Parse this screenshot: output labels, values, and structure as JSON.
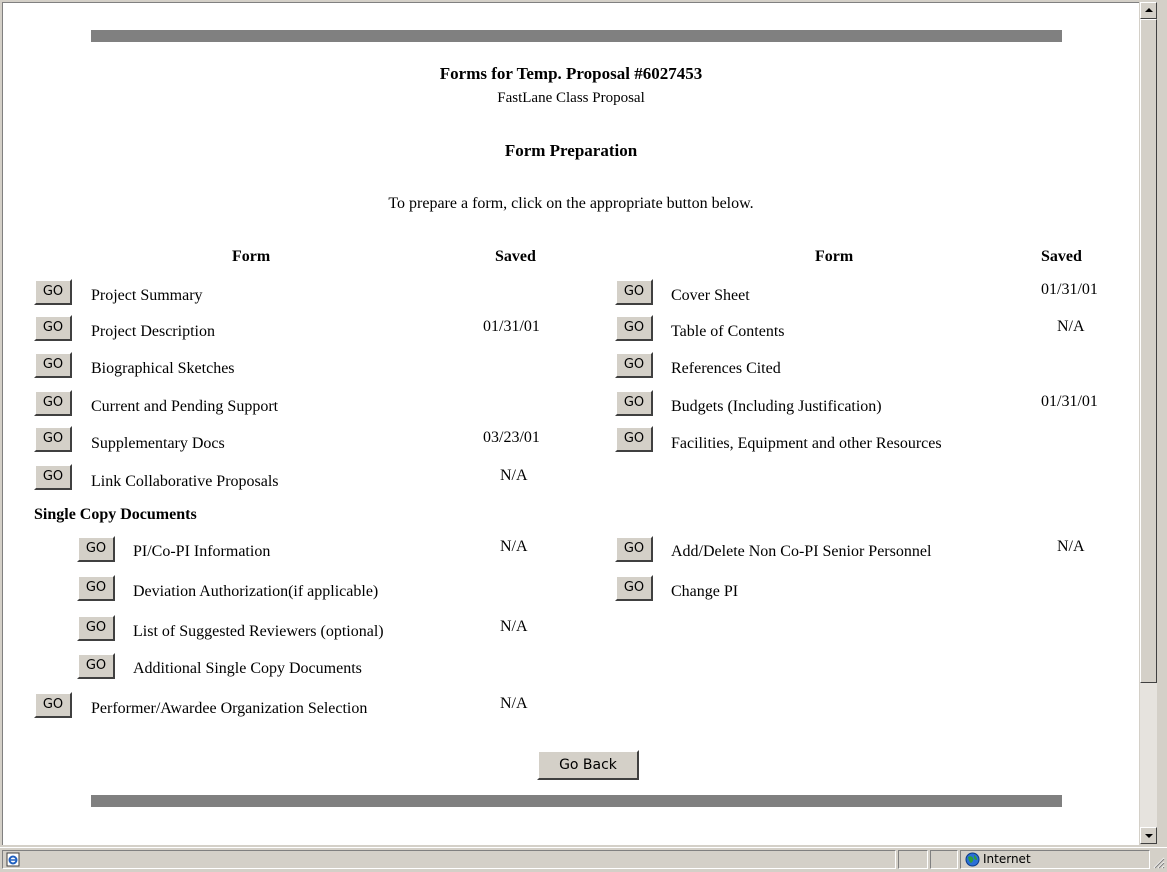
{
  "header": {
    "title": "Forms for Temp. Proposal #6027453",
    "subtitle": "FastLane Class Proposal",
    "section": "Form Preparation",
    "instruction": "To prepare a form, click on the appropriate button below."
  },
  "columns": {
    "form": "Form",
    "saved": "Saved"
  },
  "go_label": "GO",
  "left_forms": [
    {
      "label": "Project Summary",
      "saved": ""
    },
    {
      "label": "Project Description",
      "saved": "01/31/01"
    },
    {
      "label": "Biographical Sketches",
      "saved": ""
    },
    {
      "label": "Current and Pending Support",
      "saved": ""
    },
    {
      "label": "Supplementary Docs",
      "saved": "03/23/01"
    },
    {
      "label": "Link Collaborative Proposals",
      "saved": "N/A"
    }
  ],
  "right_forms": [
    {
      "label": "Cover Sheet",
      "saved": "01/31/01"
    },
    {
      "label": "Table of Contents",
      "saved": "N/A"
    },
    {
      "label": "References Cited",
      "saved": ""
    },
    {
      "label": "Budgets (Including Justification)",
      "saved": "01/31/01"
    },
    {
      "label": "Facilities, Equipment and other Resources",
      "saved": ""
    }
  ],
  "single_copy": {
    "heading": "Single Copy Documents",
    "left": [
      {
        "label": "PI/Co-PI Information",
        "saved": "N/A"
      },
      {
        "label": "Deviation Authorization(if applicable)",
        "saved": ""
      },
      {
        "label": "List of Suggested Reviewers (optional)",
        "saved": "N/A"
      },
      {
        "label": "Additional Single Copy Documents",
        "saved": ""
      }
    ],
    "right": [
      {
        "label": "Add/Delete Non Co-PI Senior Personnel",
        "saved": "N/A"
      },
      {
        "label": "Change PI",
        "saved": ""
      }
    ]
  },
  "performer": {
    "label": "Performer/Awardee Organization Selection",
    "saved": "N/A"
  },
  "go_back_label": "Go Back",
  "status_bar": {
    "zone": "Internet",
    "zone_icon": "globe-icon",
    "page_icon": "ie-page-icon"
  }
}
